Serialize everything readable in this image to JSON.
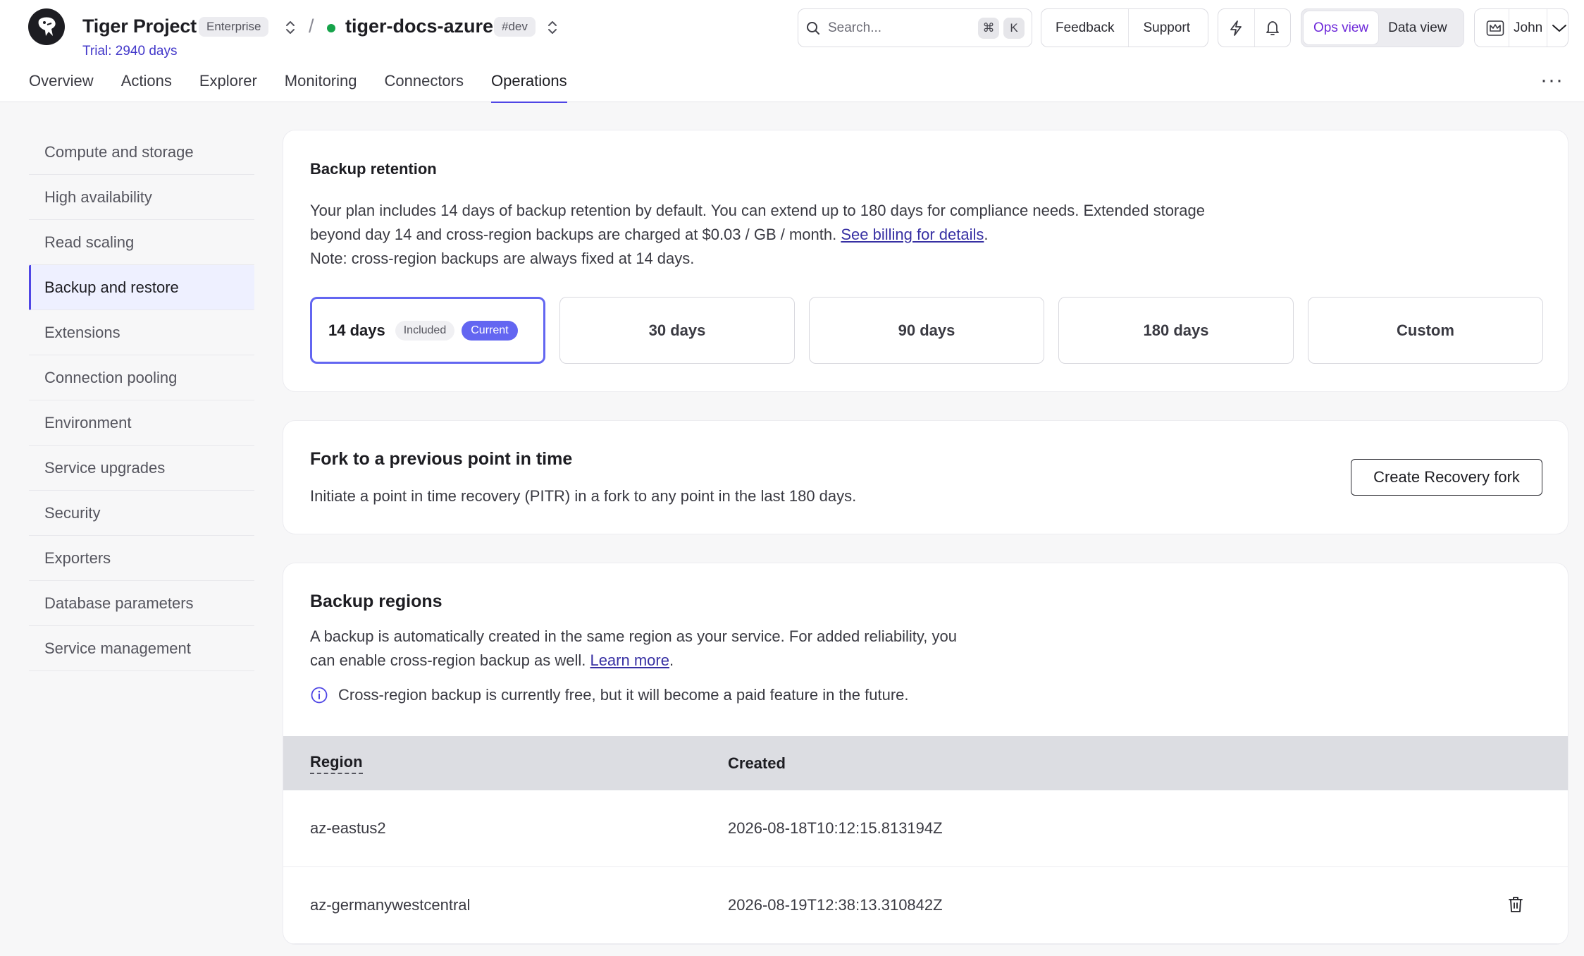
{
  "header": {
    "project_name": "Tiger Project",
    "plan_badge": "Enterprise",
    "trial": "Trial: 2940 days",
    "separator": "/",
    "service_name": "tiger-docs-azure",
    "env_badge": "#dev",
    "status_color": "#16a34a",
    "search_placeholder": "Search...",
    "search_shortcut_1": "⌘",
    "search_shortcut_2": "K",
    "feedback": "Feedback",
    "support": "Support",
    "ops_view": "Ops view",
    "data_view": "Data view",
    "user": "John",
    "more": "···"
  },
  "tabs": [
    {
      "label": "Overview"
    },
    {
      "label": "Actions"
    },
    {
      "label": "Explorer"
    },
    {
      "label": "Monitoring"
    },
    {
      "label": "Connectors"
    },
    {
      "label": "Operations",
      "active": true
    }
  ],
  "sidebar": {
    "items": [
      {
        "label": "Compute and storage"
      },
      {
        "label": "High availability"
      },
      {
        "label": "Read scaling"
      },
      {
        "label": "Backup and restore",
        "active": true
      },
      {
        "label": "Extensions"
      },
      {
        "label": "Connection pooling"
      },
      {
        "label": "Environment"
      },
      {
        "label": "Service upgrades"
      },
      {
        "label": "Security"
      },
      {
        "label": "Exporters"
      },
      {
        "label": "Database parameters"
      },
      {
        "label": "Service management"
      }
    ]
  },
  "retention": {
    "title": "Backup retention",
    "line1": "Your plan includes 14 days of backup retention by default. You can extend up to 180 days for compliance needs. Extended storage",
    "line2_prefix": "beyond day 14 and cross-region backups are charged at $0.03 / GB / month. ",
    "line2_link": "See billing for details",
    "line2_suffix": ".",
    "line3": "Note: cross-region backups are always fixed at 14 days.",
    "options": {
      "opt1": "14 days",
      "opt1_included": "Included",
      "opt1_current": "Current",
      "opt2": "30 days",
      "opt3": "90 days",
      "opt4": "180 days",
      "opt5": "Custom"
    }
  },
  "fork": {
    "title": "Fork to a previous point in time",
    "description": "Initiate a point in time recovery (PITR) in a fork to any point in the last 180 days.",
    "button": "Create Recovery fork"
  },
  "regions": {
    "title": "Backup regions",
    "line1": "A backup is automatically created in the same region as your service. For added reliability, you",
    "line2_prefix": "can enable cross-region backup as well. ",
    "line2_link": "Learn more",
    "line2_suffix": ".",
    "info": "Cross-region backup is currently free, but it will become a paid feature in the future.",
    "columns": {
      "region": "Region",
      "created": "Created"
    },
    "rows": [
      {
        "region": "az-eastus2",
        "created": "2026-08-18T10:12:15.813194Z"
      },
      {
        "region": "az-germanywestcentral",
        "created": "2026-08-19T12:38:13.310842Z"
      }
    ]
  },
  "colors": {
    "accent": "#4f46e5",
    "link": "#3730a3",
    "selected_border": "#6366f1",
    "ops_view_text": "#6d28d9"
  }
}
